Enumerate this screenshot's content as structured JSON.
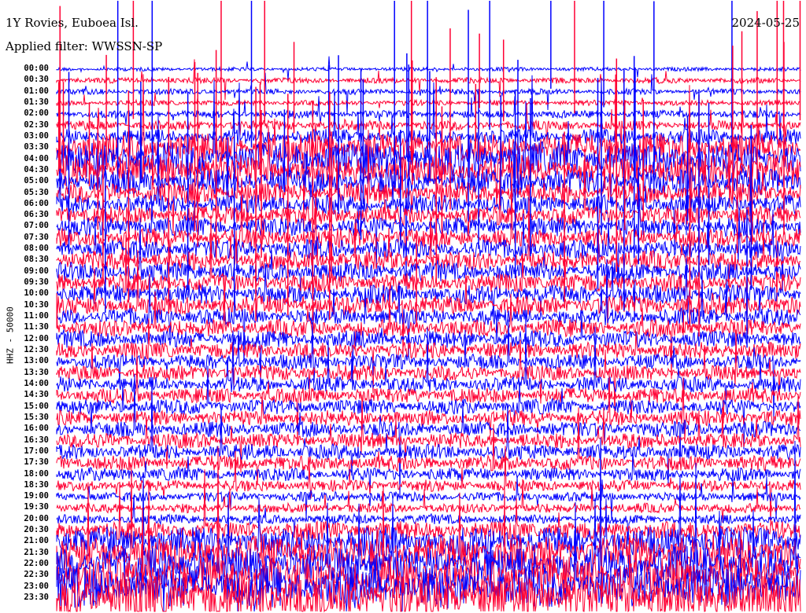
{
  "header": {
    "station": "1Y Rovies, Euboea Isl.",
    "filter": "Applied filter: WWSSN-SP",
    "date": "2024-05-25"
  },
  "chart_data": {
    "type": "line",
    "title": "1Y Rovies, Euboea Isl.",
    "subtitle": "Applied filter: WWSSN-SP",
    "ylabel": "HHZ - 50000",
    "xlabel": "",
    "series_colors": [
      "#0000ff",
      "#ff0033"
    ],
    "rows": [
      "00:00",
      "00:30",
      "01:00",
      "01:30",
      "02:00",
      "02:30",
      "03:00",
      "03:30",
      "04:00",
      "04:30",
      "05:00",
      "05:30",
      "06:00",
      "06:30",
      "07:00",
      "07:30",
      "08:00",
      "08:30",
      "09:00",
      "09:30",
      "10:00",
      "10:30",
      "11:00",
      "11:30",
      "12:00",
      "12:30",
      "13:00",
      "13:30",
      "14:00",
      "14:30",
      "15:00",
      "15:30",
      "16:00",
      "16:30",
      "17:00",
      "17:30",
      "18:00",
      "18:30",
      "19:00",
      "19:30",
      "20:00",
      "20:30",
      "21:00",
      "21:30",
      "22:00",
      "22:30",
      "23:00",
      "23:30"
    ],
    "relative_amplitude": [
      0.2,
      0.3,
      0.3,
      0.3,
      0.4,
      0.5,
      0.8,
      1.5,
      1.8,
      1.6,
      1.3,
      1.1,
      1.0,
      1.0,
      1.0,
      1.0,
      1.0,
      1.0,
      1.0,
      1.0,
      1.0,
      1.0,
      0.9,
      0.9,
      0.9,
      0.9,
      0.8,
      0.8,
      0.8,
      0.8,
      0.8,
      0.8,
      0.8,
      0.8,
      0.8,
      0.8,
      0.7,
      0.6,
      0.5,
      0.5,
      0.5,
      1.0,
      1.6,
      1.8,
      1.9,
      2.0,
      2.2,
      2.5
    ]
  }
}
